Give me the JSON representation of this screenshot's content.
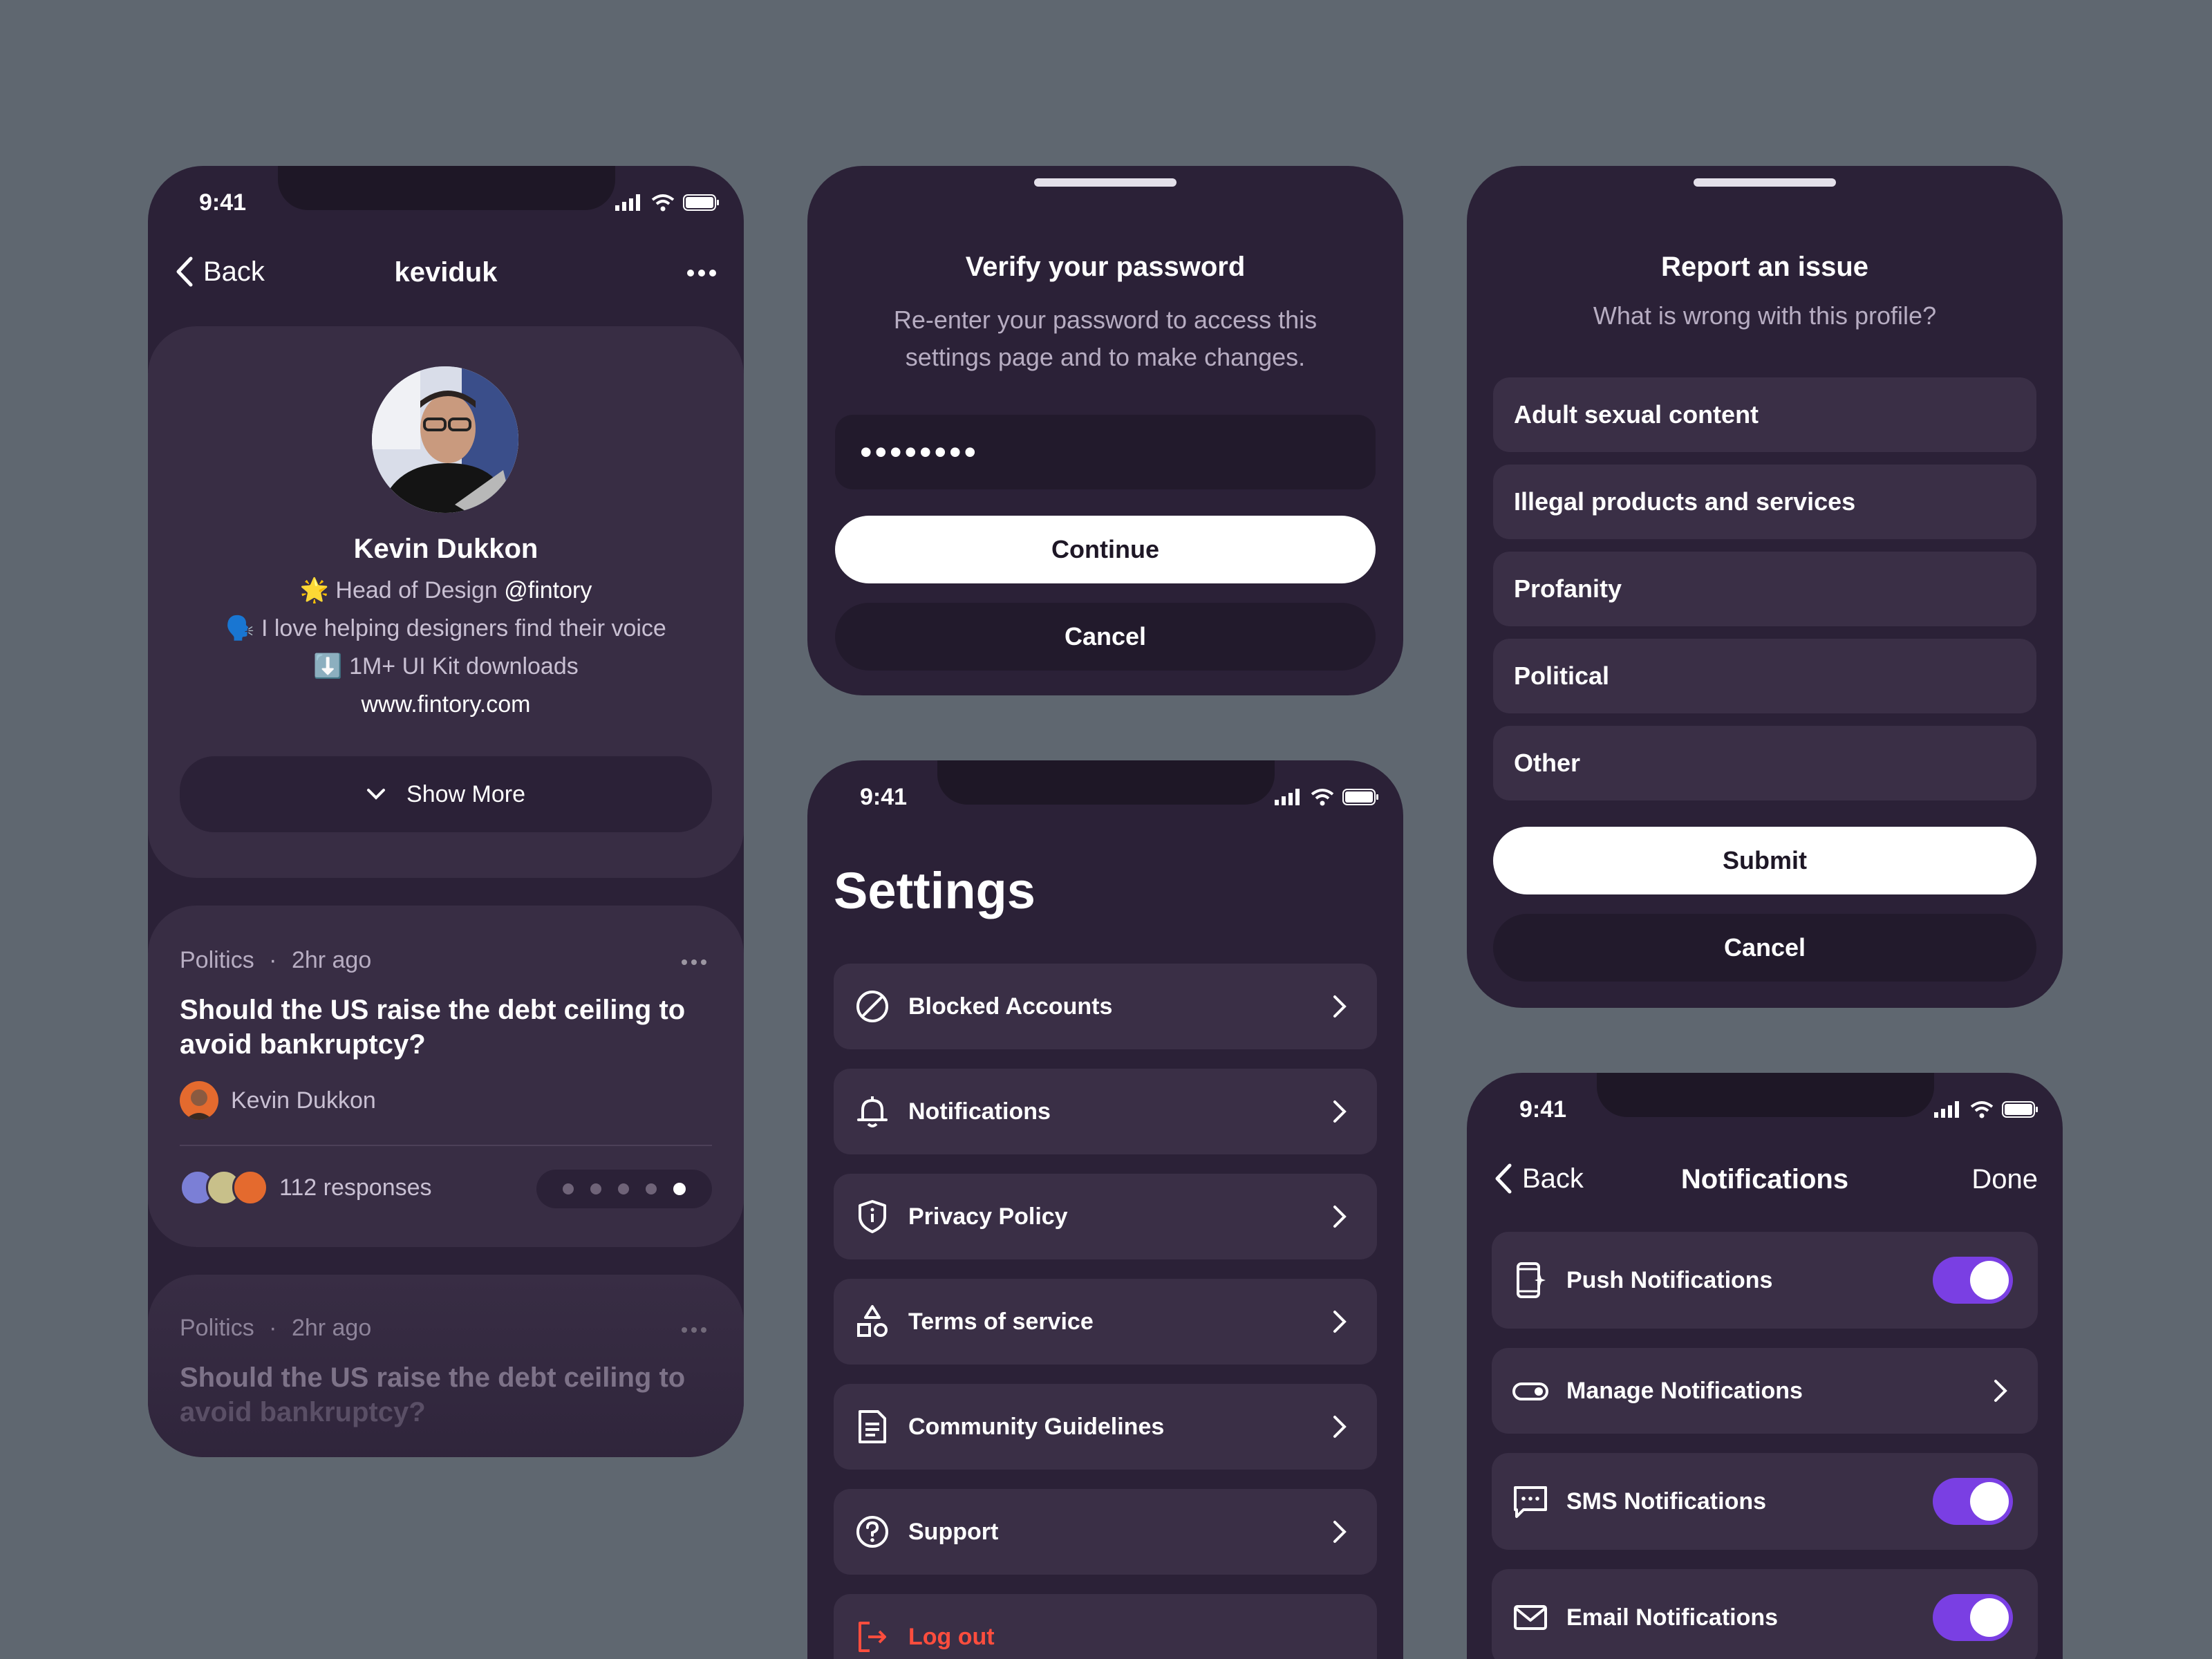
{
  "status": {
    "time": "9:41"
  },
  "profile": {
    "back_label": "Back",
    "username": "keviduk",
    "name": "Kevin Dukkon",
    "bio_line1_prefix": "Head of Design",
    "bio_line1_handle": "@fintory",
    "bio_line2": "I love helping designers find their voice",
    "bio_line3": "1M+ UI Kit downloads",
    "website": "www.fintory.com",
    "show_more_label": "Show More",
    "posts": [
      {
        "category": "Politics",
        "time": "2hr ago",
        "title_line1": "Should the US raise the debt ceiling to",
        "title_line2": "avoid bankruptcy?",
        "author": "Kevin Dukkon",
        "responses": "112 responses"
      },
      {
        "category": "Politics",
        "time": "2hr ago",
        "title_line1": "Should the US raise the debt ceiling to",
        "title_line2": "avoid bankruptcy?"
      }
    ]
  },
  "verify": {
    "title": "Verify your password",
    "subtitle_line1": "Re-enter your password to access this",
    "subtitle_line2": "settings page and to make changes.",
    "password_mask": "••••••••",
    "continue_label": "Continue",
    "cancel_label": "Cancel"
  },
  "settings": {
    "title": "Settings",
    "items": [
      {
        "label": "Blocked Accounts",
        "icon": "blocked-icon"
      },
      {
        "label": "Notifications",
        "icon": "bell-icon"
      },
      {
        "label": "Privacy Policy",
        "icon": "shield-icon"
      },
      {
        "label": "Terms of service",
        "icon": "shapes-icon"
      },
      {
        "label": "Community Guidelines",
        "icon": "document-icon"
      },
      {
        "label": "Support",
        "icon": "help-icon"
      }
    ],
    "logout_label": "Log out",
    "logout_color": "#ff4d3d"
  },
  "report": {
    "title": "Report an issue",
    "subtitle": "What is wrong with this profile?",
    "options": [
      "Adult sexual content",
      "Illegal products and services",
      "Profanity",
      "Political",
      "Other"
    ],
    "submit_label": "Submit",
    "cancel_label": "Cancel"
  },
  "notifications": {
    "back_label": "Back",
    "title": "Notifications",
    "done_label": "Done",
    "items": [
      {
        "label": "Push Notifications",
        "control": "toggle",
        "on": true
      },
      {
        "label": "Manage Notifications",
        "control": "chevron"
      },
      {
        "label": "SMS Notifications",
        "control": "toggle",
        "on": true
      },
      {
        "label": "Email Notifications",
        "control": "toggle",
        "on": true
      }
    ],
    "toggle_color": "#7a3fe3"
  }
}
